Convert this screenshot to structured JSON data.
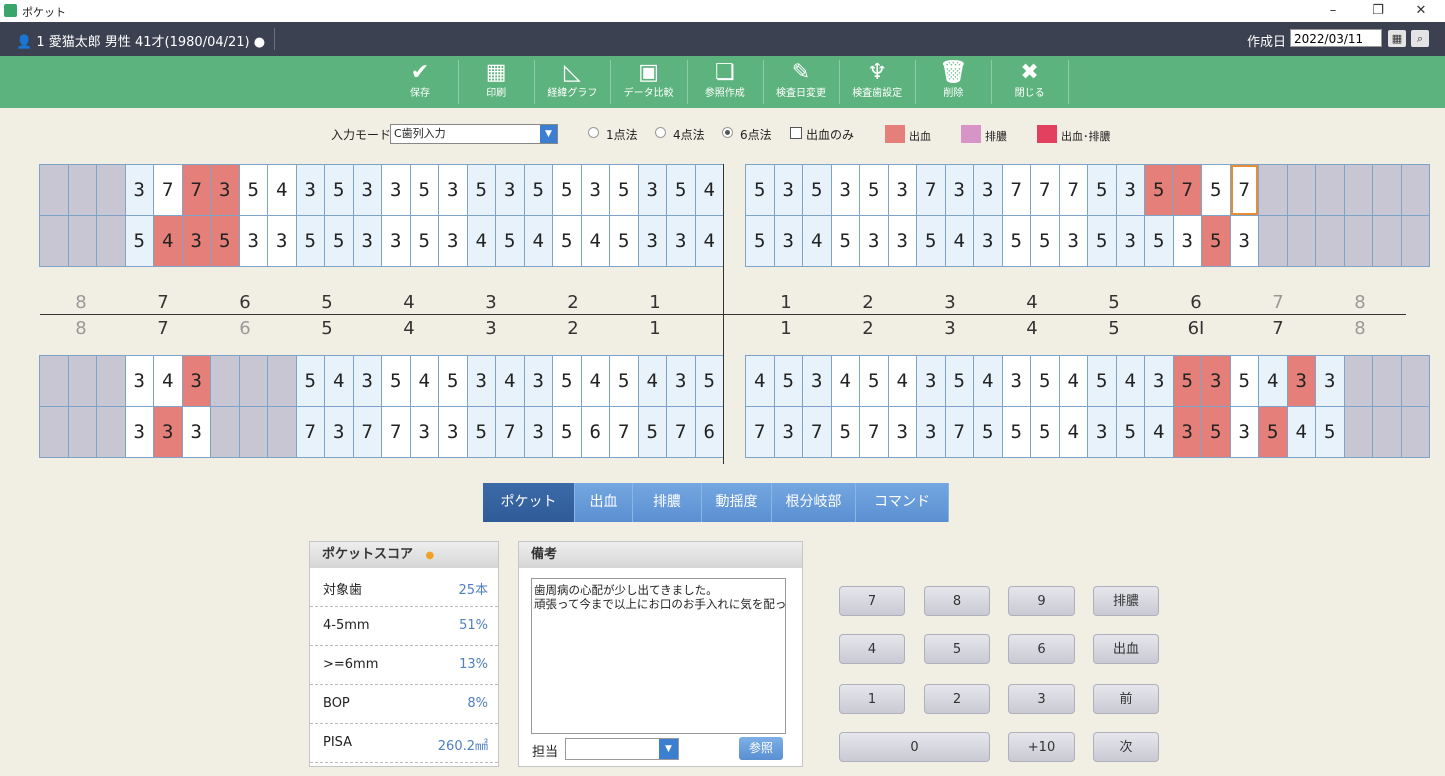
{
  "window": {
    "title": "ポケット",
    "minimize": "–",
    "restore": "❐",
    "close": "✕"
  },
  "patient": {
    "info": "1 愛猫太郎 男性 41才(1980/04/21)",
    "dot": "●",
    "date_label": "作成日",
    "date_value": "2022/03/11",
    "calendar_icon": "▦",
    "search_icon": "⌕"
  },
  "toolbar": [
    {
      "label": "保存",
      "icon": "✔"
    },
    {
      "label": "印刷",
      "icon": "▦"
    },
    {
      "label": "経緯グラフ",
      "icon": "◺"
    },
    {
      "label": "データ比較",
      "icon": "▣"
    },
    {
      "label": "参照作成",
      "icon": "❏"
    },
    {
      "label": "検査日変更",
      "icon": "✎"
    },
    {
      "label": "検査歯設定",
      "icon": "♆"
    },
    {
      "label": "削除",
      "icon": "🗑"
    },
    {
      "label": "閉じる",
      "icon": "✖"
    }
  ],
  "mode": {
    "label": "入力モード",
    "select_value": "C歯列入力",
    "select_arrow": "▼",
    "radios": [
      {
        "label": "1点法",
        "checked": false
      },
      {
        "label": "4点法",
        "checked": false
      },
      {
        "label": "6点法",
        "checked": true
      }
    ],
    "checkbox_label": "出血のみ",
    "legend": [
      {
        "label": "出血",
        "color": "#e57f79"
      },
      {
        "label": "排膿",
        "color": "#d695c6"
      },
      {
        "label": "出血･排膿",
        "color": "#e33f5f"
      }
    ]
  },
  "teeth_upper_left": [
    {
      "n": "8",
      "dim": true
    },
    {
      "n": "7",
      "dim": false
    },
    {
      "n": "6",
      "dim": false
    },
    {
      "n": "5",
      "dim": false
    },
    {
      "n": "4",
      "dim": false
    },
    {
      "n": "3",
      "dim": false
    },
    {
      "n": "2",
      "dim": false
    },
    {
      "n": "1",
      "dim": false
    }
  ],
  "teeth_upper_right": [
    {
      "n": "1",
      "dim": false
    },
    {
      "n": "2",
      "dim": false
    },
    {
      "n": "3",
      "dim": false
    },
    {
      "n": "4",
      "dim": false
    },
    {
      "n": "5",
      "dim": false
    },
    {
      "n": "6",
      "dim": false
    },
    {
      "n": "7",
      "dim": true
    },
    {
      "n": "8",
      "dim": true
    }
  ],
  "teeth_lower_left": [
    {
      "n": "8",
      "dim": true
    },
    {
      "n": "7",
      "dim": false
    },
    {
      "n": "6",
      "dim": true
    },
    {
      "n": "5",
      "dim": false
    },
    {
      "n": "4",
      "dim": false
    },
    {
      "n": "3",
      "dim": false
    },
    {
      "n": "2",
      "dim": false
    },
    {
      "n": "1",
      "dim": false
    }
  ],
  "teeth_lower_right": [
    {
      "n": "1",
      "dim": false
    },
    {
      "n": "2",
      "dim": false
    },
    {
      "n": "3",
      "dim": false
    },
    {
      "n": "4",
      "dim": false
    },
    {
      "n": "5",
      "dim": false
    },
    {
      "n": "6I",
      "dim": false
    },
    {
      "n": "7",
      "dim": false
    },
    {
      "n": "8",
      "dim": true
    }
  ],
  "grids": {
    "upper_left": [
      [
        "g:",
        "g:",
        "g:",
        "b:3",
        "w:7",
        "r:7",
        "r:3",
        "w:5",
        "w:4",
        "b:3",
        "b:5",
        "b:3",
        "w:3",
        "w:5",
        "w:3",
        "b:5",
        "b:3",
        "b:5",
        "w:5",
        "w:3",
        "w:5",
        "b:3",
        "b:5",
        "b:4"
      ],
      [
        "g:",
        "g:",
        "g:",
        "b:5",
        "r:4",
        "r:3",
        "r:5",
        "w:3",
        "w:3",
        "b:5",
        "b:5",
        "b:3",
        "w:3",
        "w:5",
        "w:3",
        "b:4",
        "b:5",
        "b:4",
        "w:5",
        "w:4",
        "w:5",
        "b:3",
        "b:3",
        "b:4"
      ]
    ],
    "upper_right": [
      [
        "b:5",
        "b:3",
        "b:5",
        "w:3",
        "w:5",
        "w:3",
        "b:7",
        "b:3",
        "b:3",
        "w:7",
        "w:7",
        "w:7",
        "b:5",
        "b:3",
        "r:5",
        "r:7",
        "w:5",
        "sel:7",
        "g:",
        "g:",
        "g:",
        "g:",
        "g:",
        "g:"
      ],
      [
        "b:5",
        "b:3",
        "b:4",
        "w:5",
        "w:3",
        "w:3",
        "b:5",
        "b:4",
        "b:3",
        "w:5",
        "w:5",
        "w:3",
        "b:5",
        "b:3",
        "b:5",
        "w:3",
        "r:5",
        "w:3",
        "g:",
        "g:",
        "g:",
        "g:",
        "g:",
        "g:"
      ]
    ],
    "lower_left": [
      [
        "g:",
        "g:",
        "g:",
        "w:3",
        "w:4",
        "r:3",
        "g:",
        "g:",
        "g:",
        "b:5",
        "b:4",
        "b:3",
        "w:5",
        "w:4",
        "w:5",
        "b:3",
        "b:4",
        "b:3",
        "w:5",
        "w:4",
        "w:5",
        "b:4",
        "b:3",
        "b:5"
      ],
      [
        "g:",
        "g:",
        "g:",
        "w:3",
        "r:3",
        "w:3",
        "g:",
        "g:",
        "g:",
        "b:7",
        "b:3",
        "b:7",
        "w:7",
        "w:3",
        "w:3",
        "b:5",
        "b:7",
        "b:3",
        "w:5",
        "w:6",
        "w:7",
        "b:5",
        "b:7",
        "b:6"
      ]
    ],
    "lower_right": [
      [
        "b:4",
        "b:5",
        "b:3",
        "w:4",
        "w:5",
        "w:4",
        "b:3",
        "b:5",
        "b:4",
        "w:3",
        "w:5",
        "w:4",
        "b:5",
        "b:4",
        "b:3",
        "r:5",
        "r:3",
        "w:5",
        "b:4",
        "r:3",
        "b:3",
        "g:",
        "g:",
        "g:"
      ],
      [
        "b:7",
        "b:3",
        "b:7",
        "w:5",
        "w:7",
        "w:3",
        "b:3",
        "b:7",
        "b:5",
        "w:5",
        "w:5",
        "w:4",
        "b:3",
        "b:5",
        "b:4",
        "r:3",
        "r:5",
        "w:3",
        "r:5",
        "b:4",
        "b:5",
        "g:",
        "g:",
        "g:"
      ]
    ]
  },
  "tabs": [
    {
      "label": "ポケット",
      "active": true
    },
    {
      "label": "出血",
      "active": false
    },
    {
      "label": "排膿",
      "active": false
    },
    {
      "label": "動揺度",
      "active": false
    },
    {
      "label": "根分岐部",
      "active": false
    },
    {
      "label": "コマンド",
      "active": false
    }
  ],
  "score": {
    "title": "ポケットスコア",
    "dot": "●",
    "rows": [
      {
        "label": "対象歯",
        "value": "25本"
      },
      {
        "label": "4-5mm",
        "value": "51%"
      },
      {
        "label": ">=6mm",
        "value": "13%"
      },
      {
        "label": "BOP",
        "value": "8%"
      },
      {
        "label": "PISA",
        "value": "260.2㎟"
      }
    ]
  },
  "memo": {
    "title": "備考",
    "line1": "歯周病の心配が少し出てきました。",
    "line2": "頑張って今まで以上にお口のお手入れに気を配っ",
    "staff_label": "担当",
    "staff_value": "",
    "staff_arrow": "▼",
    "ref_button": "参照"
  },
  "keypad": {
    "k7": "7",
    "k8": "8",
    "k9": "9",
    "pus": "排膿",
    "k4": "4",
    "k5": "5",
    "k6": "6",
    "bleed": "出血",
    "k1": "1",
    "k2": "2",
    "k3": "3",
    "prev": "前",
    "k0": "0",
    "plus10": "+10",
    "next": "次"
  },
  "colors": {
    "toolbar_bg": "#5db37e",
    "patient_bar_bg": "#3b4150",
    "bleed": "#e57f79",
    "tab_active": "#2f5c98",
    "tab": "#5a8fd2",
    "selected_outline": "#e98c36"
  }
}
